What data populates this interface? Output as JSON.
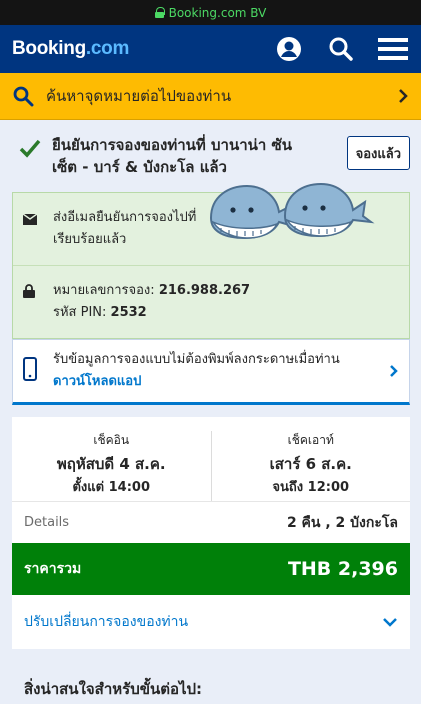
{
  "status_bar": {
    "domain": "Booking.com BV"
  },
  "header": {
    "logo_main": "Booking",
    "logo_suffix": ".com"
  },
  "search": {
    "label": "ค้นหาจุดหมายต่อไปของท่าน"
  },
  "confirmation": {
    "text": "ยืนยันการจองของท่านที่ บานาน่า ซันเซ็ต - บาร์ & บังกะโล แล้ว",
    "booked_button": "จองแล้ว"
  },
  "email_notice": {
    "line1": "ส่งอีเมลยืนยันการจองไปที่",
    "line2": "เรียบร้อยแล้ว"
  },
  "booking_info": {
    "number_label": "หมายเลขการจอง:",
    "number": "216.988.267",
    "pin_label": "รหัส PIN:",
    "pin": "2532"
  },
  "app_promo": {
    "text": "รับข้อมูลการจองแบบไม่ต้องพิมพ์ลงกระดาษเมื่อท่าน",
    "link": "ดาวน์โหลดแอป"
  },
  "checkin": {
    "label": "เช็คอิน",
    "date": "พฤหัสบดี 4 ส.ค.",
    "time": "ตั้งแต่ 14:00"
  },
  "checkout": {
    "label": "เช็คเอาท์",
    "date": "เสาร์ 6 ส.ค.",
    "time": "จนถึง 12:00"
  },
  "details": {
    "label": "Details",
    "value": "2 คืน , 2 บังกะโล"
  },
  "total": {
    "label": "ราคารวม",
    "value": "THB 2,396"
  },
  "change_booking": {
    "label": "ปรับเปลี่ยนการจองของท่าน"
  },
  "next_section": {
    "title": "สิ่งน่าสนใจสำหรับขั้นต่อไป:"
  },
  "colors": {
    "brand_blue": "#003580",
    "accent_yellow": "#febb02",
    "success_green": "#008009",
    "link_blue": "#0077cc"
  }
}
